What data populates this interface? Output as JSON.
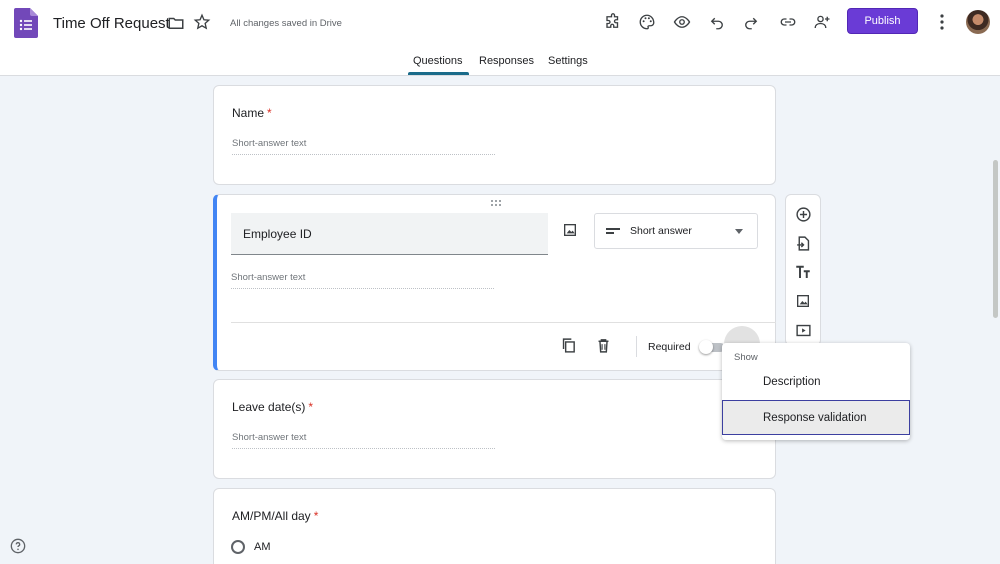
{
  "header": {
    "title": "Time Off Request",
    "save_status": "All changes saved in Drive",
    "publish_label": "Publish",
    "icons": [
      "addons-icon",
      "palette-icon",
      "preview-icon",
      "undo-icon",
      "redo-icon",
      "link-icon",
      "add-collaborator-icon",
      "more-vert-icon"
    ]
  },
  "tabs": [
    {
      "label": "Questions",
      "active": true
    },
    {
      "label": "Responses",
      "active": false
    },
    {
      "label": "Settings",
      "active": false
    }
  ],
  "questions": [
    {
      "title": "Name",
      "required": true,
      "placeholder": "Short-answer text"
    },
    {
      "title": "Employee ID",
      "type": "Short answer",
      "placeholder": "Short-answer text",
      "required_label": "Required",
      "required_on": false
    },
    {
      "title": "Leave date(s)",
      "required": true,
      "placeholder": "Short-answer text"
    },
    {
      "title": "AM/PM/All day",
      "required": true,
      "option_1": "AM"
    }
  ],
  "menu": {
    "header": "Show",
    "items": [
      "Description",
      "Response validation"
    ],
    "selected_index": 1
  },
  "side_toolbar": [
    "add-question-icon",
    "import-questions-icon",
    "add-title-icon",
    "add-image-icon",
    "add-video-icon"
  ],
  "colors": {
    "accent": "#6a3bd6",
    "active_bar": "#4285f4",
    "required": "#d93025",
    "tab_indicator": "#1a6b8a"
  }
}
